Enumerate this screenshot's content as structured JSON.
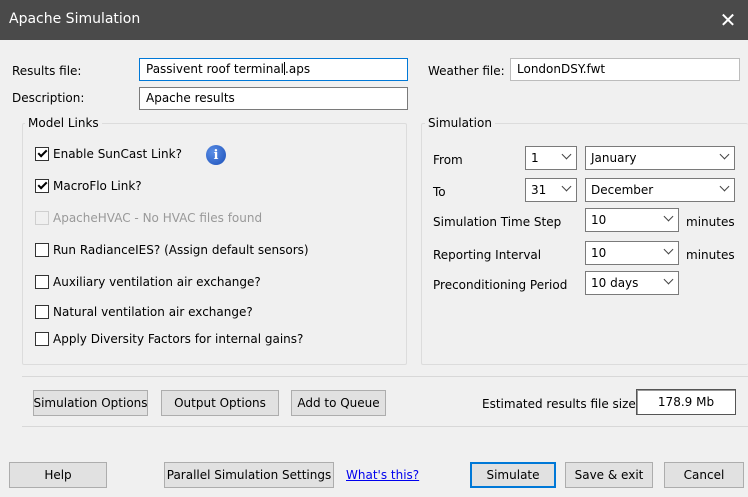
{
  "window": {
    "title": "Apache Simulation",
    "close_glyph": "✕"
  },
  "results_file": {
    "label": "Results file:",
    "value": "Passivent roof terminal.aps"
  },
  "description": {
    "label": "Description:",
    "value": "Apache results"
  },
  "weather_file": {
    "label": "Weather file:",
    "value": "LondonDSY.fwt"
  },
  "model_links": {
    "label": "Model Links",
    "items": [
      {
        "label": "Enable SunCast Link?",
        "checked": true,
        "enabled": true
      },
      {
        "label": "MacroFlo Link?",
        "checked": true,
        "enabled": true
      },
      {
        "label": "ApacheHVAC - No HVAC files found",
        "checked": false,
        "enabled": false
      },
      {
        "label": "Run RadianceIES? (Assign default sensors)",
        "checked": false,
        "enabled": true
      },
      {
        "label": "Auxiliary ventilation air exchange?",
        "checked": false,
        "enabled": true
      },
      {
        "label": "Natural ventilation air exchange?",
        "checked": false,
        "enabled": true
      },
      {
        "label": "Apply Diversity Factors for internal gains?",
        "checked": false,
        "enabled": true
      }
    ],
    "info_glyph": "i"
  },
  "simulation": {
    "label": "Simulation",
    "from": {
      "label": "From",
      "day": "1",
      "month": "January"
    },
    "to": {
      "label": "To",
      "day": "31",
      "month": "December"
    },
    "time_step": {
      "label": "Simulation Time Step",
      "value": "10",
      "unit": "minutes"
    },
    "reporting_interval": {
      "label": "Reporting Interval",
      "value": "10",
      "unit": "minutes"
    },
    "preconditioning": {
      "label": "Preconditioning Period",
      "value": "10 days"
    }
  },
  "actions": {
    "simulation_options": "Simulation Options",
    "output_options": "Output Options",
    "add_to_queue": "Add to Queue",
    "estimated_size_label": "Estimated results file size",
    "estimated_size_value": "178.9 Mb"
  },
  "footer": {
    "help": "Help",
    "parallel_settings": "Parallel Simulation Settings",
    "whats_this": "What's this?",
    "simulate": "Simulate",
    "save_exit": "Save & exit",
    "cancel": "Cancel"
  },
  "colors": {
    "titlebar": "#4a4a4a",
    "focus": "#0078d7",
    "link": "#0000ee"
  }
}
